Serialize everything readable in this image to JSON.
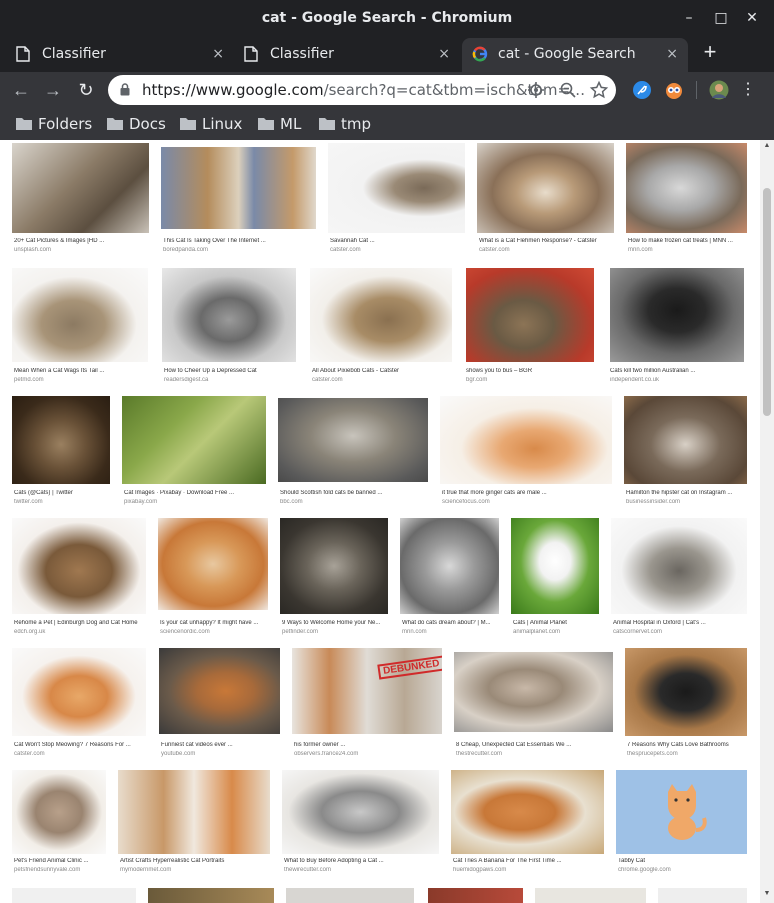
{
  "window": {
    "title": "cat - Google Search - Chromium",
    "controls": {
      "minimize": "–",
      "maximize": "□",
      "close": "✕"
    }
  },
  "tabs": [
    {
      "label": "Classifier",
      "icon": "page-icon",
      "close": "×"
    },
    {
      "label": "Classifier",
      "icon": "page-icon",
      "close": "×"
    },
    {
      "label": "cat - Google Search",
      "icon": "google-icon",
      "close": "×",
      "active": true
    }
  ],
  "new_tab": "+",
  "toolbar": {
    "back": "←",
    "forward": "→",
    "reload": "↻",
    "url_host": "https://www.google.com",
    "url_rest": "/search?q=cat&tbm=isch&tbm=…"
  },
  "bookmarks": [
    "Folders",
    "Docs",
    "Linux",
    "ML",
    "tmp"
  ],
  "colors": {
    "chrome_dark": "#202124",
    "chrome_toolbar": "#35363a",
    "omnibox": "#ffffff"
  },
  "results": [
    {
      "caption": "20+ Cat Pictures & Images [HD ...",
      "source": "unsplash.com"
    },
    {
      "caption": "This Cat Is Taking Over The Internet ...",
      "source": "boredpanda.com"
    },
    {
      "caption": "Savannah Cat ...",
      "source": "catster.com"
    },
    {
      "caption": "What is a Cat Flehmen Response? - Catster",
      "source": "catster.com"
    },
    {
      "caption": "How to make frozen cat treats | MNN ...",
      "source": "mnn.com"
    },
    {
      "caption": "Mean When a Cat Wags Its Tail ...",
      "source": "petmd.com"
    },
    {
      "caption": "How to Cheer Up a Depressed Cat",
      "source": "readersdigest.ca"
    },
    {
      "caption": "All About Pixiebob Cats - Catster",
      "source": "catster.com"
    },
    {
      "caption": "shows you to bus – BGR",
      "source": "bgr.com"
    },
    {
      "caption": "Cats kill two million Australian ...",
      "source": "independent.co.uk"
    },
    {
      "caption": "Cats (@Cats) | Twitter",
      "source": "twitter.com"
    },
    {
      "caption": "Cat Images · Pixabay · Download Free ...",
      "source": "pixabay.com"
    },
    {
      "caption": "Should Scottish fold cats be banned ...",
      "source": "bbc.com"
    },
    {
      "caption": "it true that more ginger cats are male ...",
      "source": "sciencefocus.com"
    },
    {
      "caption": "Hamilton the hipster cat on Instagram ...",
      "source": "businessinsider.com"
    },
    {
      "caption": "Rehome a Pet | Edinburgh Dog and Cat Home",
      "source": "edch.org.uk"
    },
    {
      "caption": "Is your cat unhappy? It might have ...",
      "source": "sciencenordic.com"
    },
    {
      "caption": "9 Ways to Welcome Home your Ne...",
      "source": "petfinder.com"
    },
    {
      "caption": "What do cats dream about? | M...",
      "source": "mnn.com"
    },
    {
      "caption": "Cats | Animal Planet",
      "source": "animalplanet.com"
    },
    {
      "caption": "Animal Hospital in Oxford | Cat's ...",
      "source": "catscornervet.com"
    },
    {
      "caption": "Cat Won't Stop Meowing? 7 Reasons For ...",
      "source": "catster.com"
    },
    {
      "caption": "Funniest cat videos ever ...",
      "source": "youtube.com"
    },
    {
      "caption": "his former owner ...",
      "source": "observers.france24.com"
    },
    {
      "caption": "8 Cheap, Unexpected Cat Essentials We ...",
      "source": "thestrecutter.com"
    },
    {
      "caption": "7 Reasons Why Cats Love Bathrooms",
      "source": "thesprucepets.com"
    },
    {
      "caption": "Pet's Friend Animal Clinic ...",
      "source": "petsfriendsunnyvale.com"
    },
    {
      "caption": "Artist Crafts Hyperrealistic Cat Portraits",
      "source": "mymodernmet.com"
    },
    {
      "caption": "What to Buy Before Adopting a Cat ...",
      "source": "thewirecutter.com"
    },
    {
      "caption": "Cat Tries A Banana For The First Time ...",
      "source": "huemidogpaws.com"
    },
    {
      "caption": "Tabby Cat",
      "source": "chrome.google.com"
    }
  ],
  "stamp": "DEBUNKED",
  "scrollbar": {
    "up": "▲",
    "down": "▼"
  }
}
